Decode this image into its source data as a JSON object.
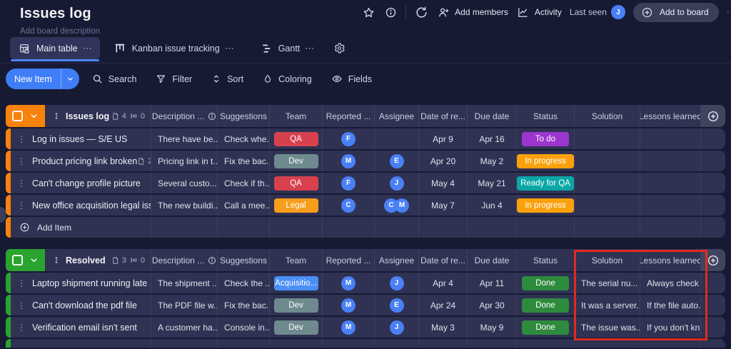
{
  "header": {
    "title": "Issues log",
    "subtitle": "Add board description",
    "add_members": "Add members",
    "activity": "Activity",
    "last_seen": "Last seen",
    "last_seen_avatar": "J",
    "add_to_board": "Add to board"
  },
  "tabs": {
    "main": "Main table",
    "kanban": "Kanban issue tracking",
    "gantt": "Gantt"
  },
  "toolbar": {
    "new_item": "New Item",
    "search": "Search",
    "filter": "Filter",
    "sort": "Sort",
    "coloring": "Coloring",
    "fields": "Fields"
  },
  "columns": {
    "description": "Description ...",
    "suggestions": "Suggestions",
    "team": "Team",
    "reported": "Reported ...",
    "assignee": "Assignee",
    "date": "Date of re...",
    "due": "Due date",
    "status": "Status",
    "solution": "Solution",
    "lessons": "Lessons learned"
  },
  "icons": {
    "ellipsis_h": "⋯",
    "dots_v": "⋮"
  },
  "colors": {
    "new_item": "#3f7ef7",
    "tab_underline": "#4c82f7",
    "avatar": "#4a80f6",
    "annotation": "#e02a1f"
  },
  "groups": [
    {
      "name": "Issues log",
      "color": "#f8820c",
      "doc_count": "4",
      "sub_count": "0",
      "add_item": "Add Item",
      "rows": [
        {
          "name": "Log in issues — S/E US",
          "desc": "There have be...",
          "sugg": "Check whe...",
          "team": "QA",
          "team_color": "#d7414e",
          "reported": [
            "F"
          ],
          "date": "Apr 9",
          "due": "Apr 16",
          "status": "To do",
          "status_color": "#9c35cf",
          "solution": "",
          "lessons": ""
        },
        {
          "name": "Product pricing link broken",
          "doc_badge": "2",
          "desc": "Pricing link in t...",
          "sugg": "Fix the bac...",
          "team": "Dev",
          "team_color": "#6e8a8e",
          "reported": [
            "M"
          ],
          "assignee": [
            "E"
          ],
          "date": "Apr 20",
          "due": "May 2",
          "status": "In progress",
          "status_color": "#fca10c",
          "solution": "",
          "lessons": ""
        },
        {
          "name": "Can't change profile picture",
          "desc": "Several custo...",
          "sugg": "Check if th...",
          "team": "QA",
          "team_color": "#d7414e",
          "reported": [
            "F"
          ],
          "assignee": [
            "J"
          ],
          "date": "May 4",
          "due": "May 21",
          "status": "Ready for QA",
          "status_color": "#0aa7a7",
          "solution": "",
          "lessons": ""
        },
        {
          "name": "New office acquisition legal issues",
          "desc": "The new buildi...",
          "sugg": "Call a mee...",
          "team": "Legal",
          "team_color": "#f89d1c",
          "reported": [
            "C"
          ],
          "assignee": [
            "C",
            "M"
          ],
          "date": "May 7",
          "due": "Jun 4",
          "status": "In progress",
          "status_color": "#fca10c",
          "solution": "",
          "lessons": ""
        }
      ]
    },
    {
      "name": "Resolved",
      "color": "#2ba32f",
      "doc_count": "3",
      "sub_count": "0",
      "rows": [
        {
          "name": "Laptop shipment running late",
          "desc": "The shipment ...",
          "sugg": "Check the ...",
          "team": "Acquisitio...",
          "team_color": "#4a8ff6",
          "reported": [
            "M"
          ],
          "assignee": [
            "J"
          ],
          "date": "Apr 4",
          "due": "Apr 11",
          "status": "Done",
          "status_color": "#2e8b3e",
          "solution": "The serial nu...",
          "lessons": "Always check ..."
        },
        {
          "name": "Can't download the pdf file",
          "desc": "The PDF file w...",
          "sugg": "Fix the bac...",
          "team": "Dev",
          "team_color": "#6e8a8e",
          "reported": [
            "M"
          ],
          "assignee": [
            "E"
          ],
          "date": "Apr 24",
          "due": "Apr 30",
          "status": "Done",
          "status_color": "#2e8b3e",
          "solution": "It was a server...",
          "lessons": "If the file auto..."
        },
        {
          "name": "Verification email isn't sent",
          "desc": "A customer ha...",
          "sugg": "Console in...",
          "team": "Dev",
          "team_color": "#6e8a8e",
          "reported": [
            "M"
          ],
          "assignee": [
            "J"
          ],
          "date": "May 3",
          "due": "May 9",
          "status": "Done",
          "status_color": "#2e8b3e",
          "solution": "The issue was...",
          "lessons": "If you don't kn..."
        }
      ]
    }
  ]
}
